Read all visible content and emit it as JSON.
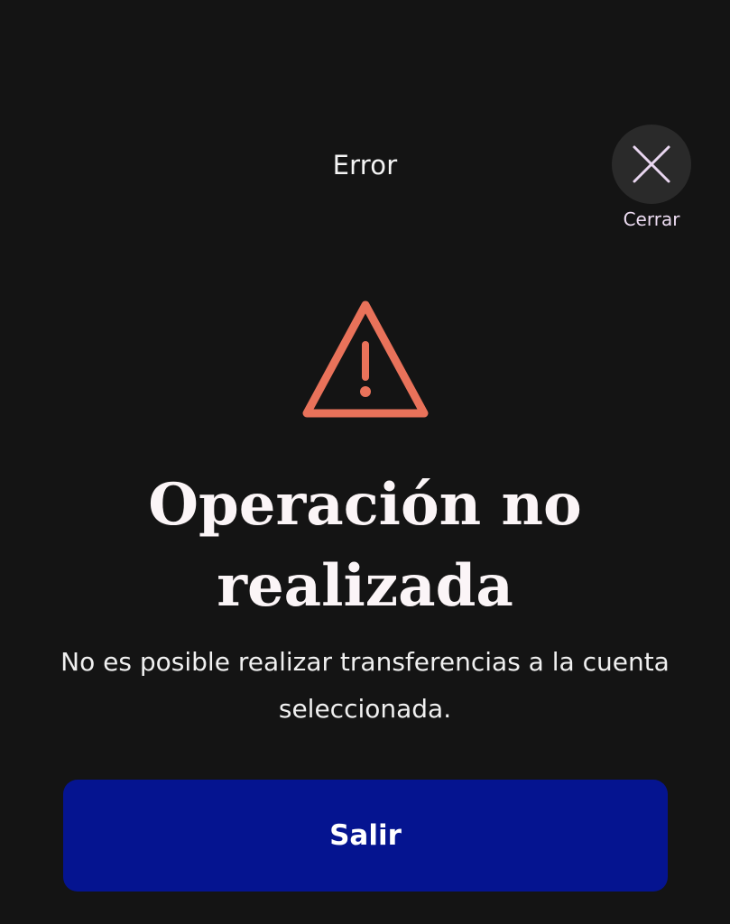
{
  "header": {
    "title": "Error"
  },
  "close": {
    "label": "Cerrar",
    "icon": "close-icon"
  },
  "alert": {
    "icon": "warning-triangle-icon",
    "icon_color": "#e9725a",
    "title": "Operación no realizada",
    "message": "No es posible realizar transferencias a la cuenta seleccionada."
  },
  "actions": {
    "primary_label": "Salir",
    "primary_color": "#051490"
  }
}
